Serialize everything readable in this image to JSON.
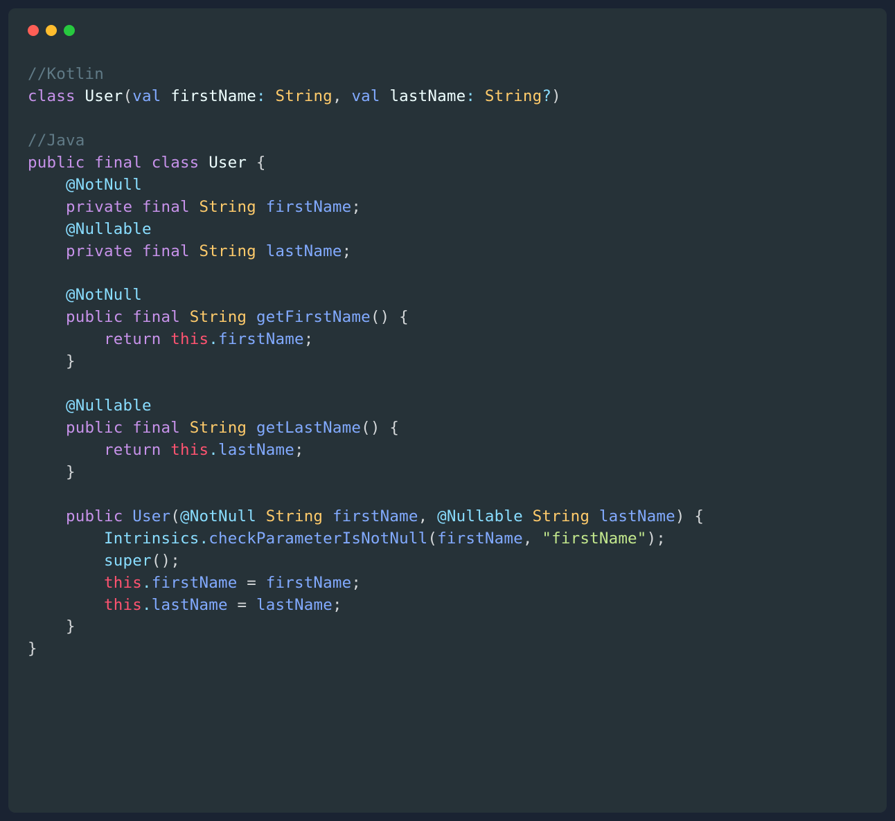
{
  "colors": {
    "background_outer": "#1a2332",
    "background_window": "#263238",
    "dot_red": "#ff5f56",
    "dot_yellow": "#ffbd2e",
    "dot_green": "#27c93f",
    "text_default": "#d4d7d9",
    "comment": "#607a86",
    "keyword": "#c792ea",
    "blue": "#82aaff",
    "type": "#ffcb6b",
    "annotation": "#89ddff",
    "this": "#ff5370",
    "string": "#c3e88d"
  },
  "code": {
    "lines": [
      [
        {
          "t": "//Kotlin",
          "c": "c-comment"
        }
      ],
      [
        {
          "t": "class ",
          "c": "c-keyword"
        },
        {
          "t": "User",
          "c": "c-name"
        },
        {
          "t": "(",
          "c": "c-paren"
        },
        {
          "t": "val ",
          "c": "c-blue"
        },
        {
          "t": "firstName",
          "c": "c-name"
        },
        {
          "t": ": ",
          "c": "c-teal"
        },
        {
          "t": "String",
          "c": "c-type"
        },
        {
          "t": ", ",
          "c": "c-paren"
        },
        {
          "t": "val ",
          "c": "c-blue"
        },
        {
          "t": "lastName",
          "c": "c-name"
        },
        {
          "t": ": ",
          "c": "c-teal"
        },
        {
          "t": "String",
          "c": "c-type"
        },
        {
          "t": "?",
          "c": "c-teal"
        },
        {
          "t": ")",
          "c": "c-paren"
        }
      ],
      [
        {
          "t": "",
          "c": ""
        }
      ],
      [
        {
          "t": "//Java",
          "c": "c-comment"
        }
      ],
      [
        {
          "t": "public final class ",
          "c": "c-keyword"
        },
        {
          "t": "User ",
          "c": "c-name"
        },
        {
          "t": "{",
          "c": "c-paren"
        }
      ],
      [
        {
          "t": "    ",
          "c": ""
        },
        {
          "t": "@NotNull",
          "c": "c-ann"
        }
      ],
      [
        {
          "t": "    ",
          "c": ""
        },
        {
          "t": "private final ",
          "c": "c-keyword"
        },
        {
          "t": "String ",
          "c": "c-type"
        },
        {
          "t": "firstName",
          "c": "c-blue"
        },
        {
          "t": ";",
          "c": "c-paren"
        }
      ],
      [
        {
          "t": "    ",
          "c": ""
        },
        {
          "t": "@Nullable",
          "c": "c-ann"
        }
      ],
      [
        {
          "t": "    ",
          "c": ""
        },
        {
          "t": "private final ",
          "c": "c-keyword"
        },
        {
          "t": "String ",
          "c": "c-type"
        },
        {
          "t": "lastName",
          "c": "c-blue"
        },
        {
          "t": ";",
          "c": "c-paren"
        }
      ],
      [
        {
          "t": "",
          "c": ""
        }
      ],
      [
        {
          "t": "    ",
          "c": ""
        },
        {
          "t": "@NotNull",
          "c": "c-ann"
        }
      ],
      [
        {
          "t": "    ",
          "c": ""
        },
        {
          "t": "public final ",
          "c": "c-keyword"
        },
        {
          "t": "String ",
          "c": "c-type"
        },
        {
          "t": "getFirstName",
          "c": "c-func"
        },
        {
          "t": "() {",
          "c": "c-paren"
        }
      ],
      [
        {
          "t": "        ",
          "c": ""
        },
        {
          "t": "return ",
          "c": "c-keyword"
        },
        {
          "t": "this",
          "c": "c-this"
        },
        {
          "t": ".",
          "c": "c-teal"
        },
        {
          "t": "firstName",
          "c": "c-blue"
        },
        {
          "t": ";",
          "c": "c-paren"
        }
      ],
      [
        {
          "t": "    ",
          "c": ""
        },
        {
          "t": "}",
          "c": "c-paren"
        }
      ],
      [
        {
          "t": "",
          "c": ""
        }
      ],
      [
        {
          "t": "    ",
          "c": ""
        },
        {
          "t": "@Nullable",
          "c": "c-ann"
        }
      ],
      [
        {
          "t": "    ",
          "c": ""
        },
        {
          "t": "public final ",
          "c": "c-keyword"
        },
        {
          "t": "String ",
          "c": "c-type"
        },
        {
          "t": "getLastName",
          "c": "c-func"
        },
        {
          "t": "() {",
          "c": "c-paren"
        }
      ],
      [
        {
          "t": "        ",
          "c": ""
        },
        {
          "t": "return ",
          "c": "c-keyword"
        },
        {
          "t": "this",
          "c": "c-this"
        },
        {
          "t": ".",
          "c": "c-teal"
        },
        {
          "t": "lastName",
          "c": "c-blue"
        },
        {
          "t": ";",
          "c": "c-paren"
        }
      ],
      [
        {
          "t": "    ",
          "c": ""
        },
        {
          "t": "}",
          "c": "c-paren"
        }
      ],
      [
        {
          "t": "",
          "c": ""
        }
      ],
      [
        {
          "t": "    ",
          "c": ""
        },
        {
          "t": "public ",
          "c": "c-keyword"
        },
        {
          "t": "User",
          "c": "c-func"
        },
        {
          "t": "(",
          "c": "c-paren"
        },
        {
          "t": "@NotNull ",
          "c": "c-ann"
        },
        {
          "t": "String ",
          "c": "c-type"
        },
        {
          "t": "firstName",
          "c": "c-blue"
        },
        {
          "t": ", ",
          "c": "c-paren"
        },
        {
          "t": "@Nullable ",
          "c": "c-ann"
        },
        {
          "t": "String ",
          "c": "c-type"
        },
        {
          "t": "lastName",
          "c": "c-blue"
        },
        {
          "t": ") {",
          "c": "c-paren"
        }
      ],
      [
        {
          "t": "        ",
          "c": ""
        },
        {
          "t": "Intrinsics",
          "c": "c-teal"
        },
        {
          "t": ".",
          "c": "c-teal"
        },
        {
          "t": "checkParameterIsNotNull",
          "c": "c-func"
        },
        {
          "t": "(",
          "c": "c-paren"
        },
        {
          "t": "firstName",
          "c": "c-blue"
        },
        {
          "t": ", ",
          "c": "c-paren"
        },
        {
          "t": "\"firstName\"",
          "c": "c-string"
        },
        {
          "t": ");",
          "c": "c-paren"
        }
      ],
      [
        {
          "t": "        ",
          "c": ""
        },
        {
          "t": "super",
          "c": "c-teal"
        },
        {
          "t": "();",
          "c": "c-paren"
        }
      ],
      [
        {
          "t": "        ",
          "c": ""
        },
        {
          "t": "this",
          "c": "c-this"
        },
        {
          "t": ".",
          "c": "c-teal"
        },
        {
          "t": "firstName",
          "c": "c-blue"
        },
        {
          "t": " = ",
          "c": "c-paren"
        },
        {
          "t": "firstName",
          "c": "c-blue"
        },
        {
          "t": ";",
          "c": "c-paren"
        }
      ],
      [
        {
          "t": "        ",
          "c": ""
        },
        {
          "t": "this",
          "c": "c-this"
        },
        {
          "t": ".",
          "c": "c-teal"
        },
        {
          "t": "lastName",
          "c": "c-blue"
        },
        {
          "t": " = ",
          "c": "c-paren"
        },
        {
          "t": "lastName",
          "c": "c-blue"
        },
        {
          "t": ";",
          "c": "c-paren"
        }
      ],
      [
        {
          "t": "    ",
          "c": ""
        },
        {
          "t": "}",
          "c": "c-paren"
        }
      ],
      [
        {
          "t": "}",
          "c": "c-paren"
        }
      ]
    ]
  }
}
